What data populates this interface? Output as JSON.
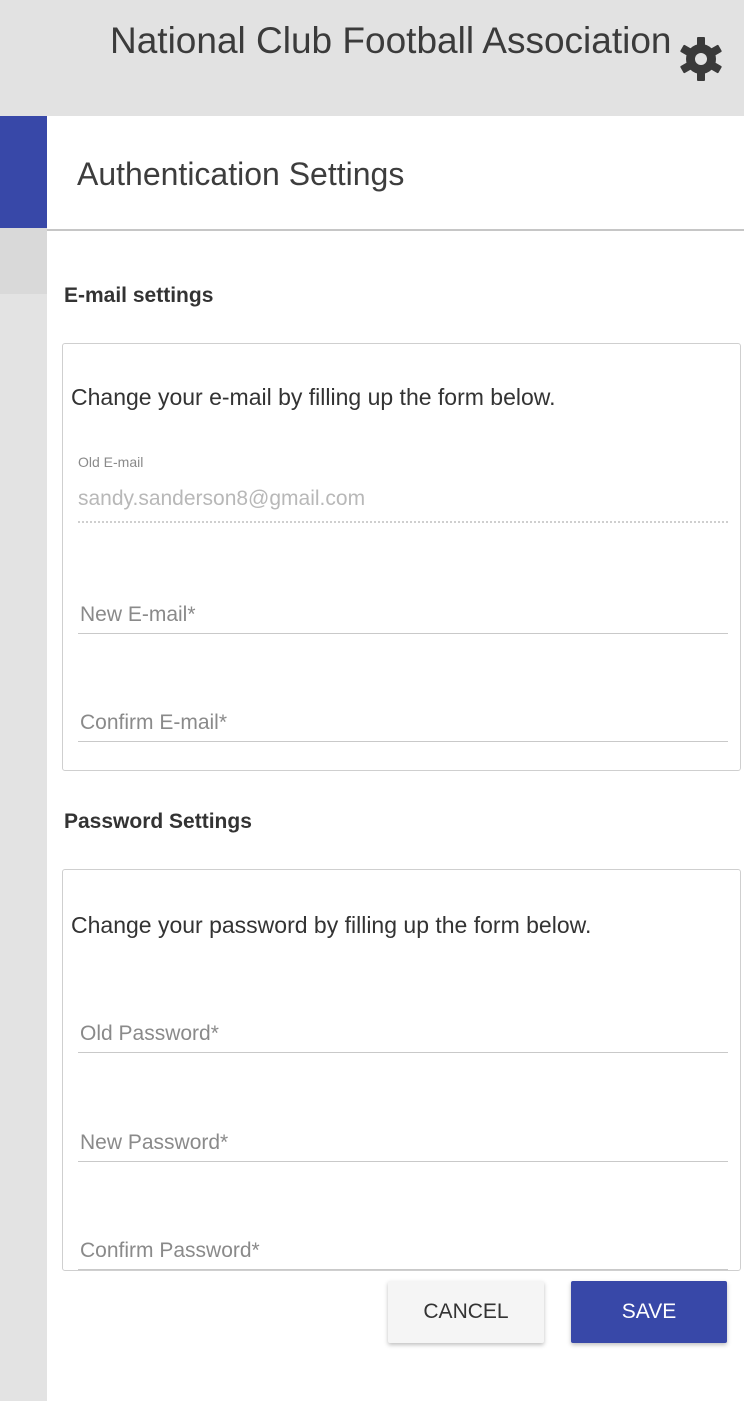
{
  "header": {
    "app_title": "National Club Football Association",
    "settings_icon": "gear-icon"
  },
  "page": {
    "title": "Authentication Settings"
  },
  "email_section": {
    "title": "E-mail settings",
    "description": "Change your e-mail by filling up the form below.",
    "old_email_label": "Old E-mail",
    "old_email_value": "sandy.sanderson8@gmail.com",
    "new_email_label": "New E-mail*",
    "confirm_email_label": "Confirm E-mail*"
  },
  "password_section": {
    "title": "Password Settings",
    "description": "Change your password by filling up the form below.",
    "old_password_label": "Old Password*",
    "new_password_label": "New Password*",
    "confirm_password_label": "Confirm Password*"
  },
  "actions": {
    "cancel_label": "CANCEL",
    "save_label": "SAVE"
  },
  "colors": {
    "accent": "#3848a8",
    "header_bg": "#e2e2e2"
  }
}
